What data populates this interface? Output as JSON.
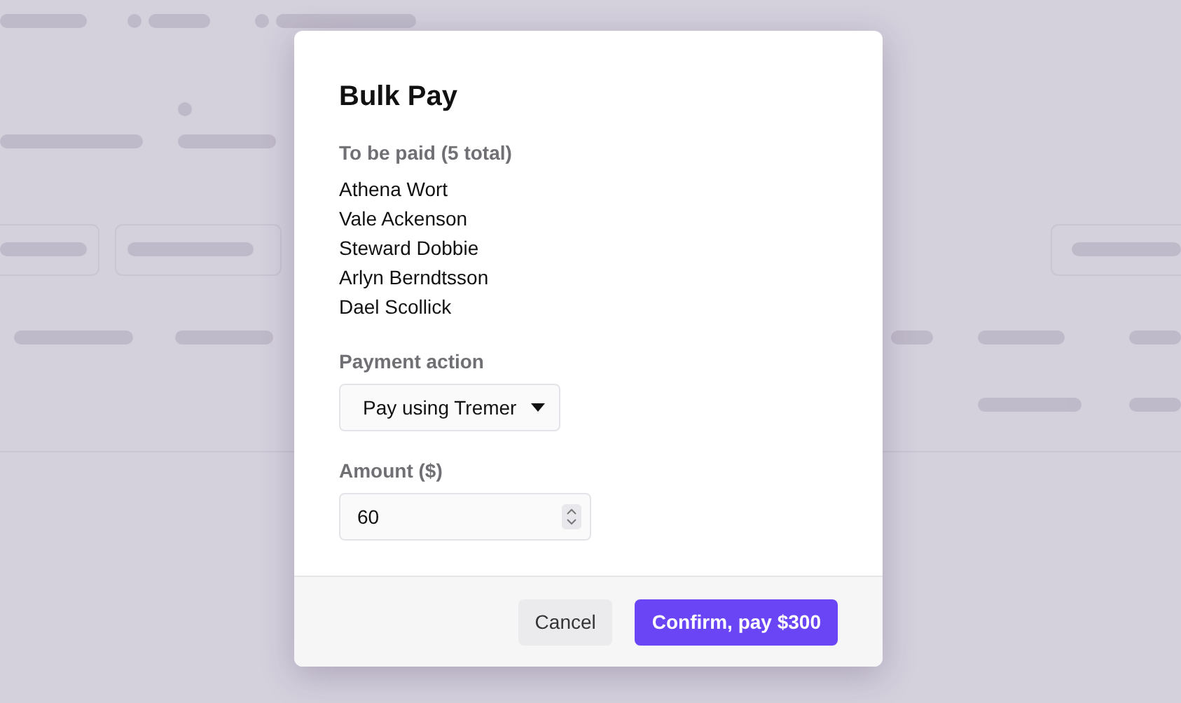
{
  "dialog": {
    "title": "Bulk Pay",
    "list_label": "To be paid (5 total)",
    "payees": [
      "Athena Wort",
      "Vale Ackenson",
      "Steward Dobbie",
      "Arlyn Berndtsson",
      "Dael Scollick"
    ],
    "payment_action": {
      "label": "Payment action",
      "value": "Pay using Tremer"
    },
    "amount": {
      "label": "Amount ($)",
      "value": "60"
    },
    "buttons": [
      {
        "label": "Cancel",
        "kind": "secondary"
      },
      {
        "label": "Confirm, pay $300",
        "kind": "primary"
      }
    ]
  }
}
